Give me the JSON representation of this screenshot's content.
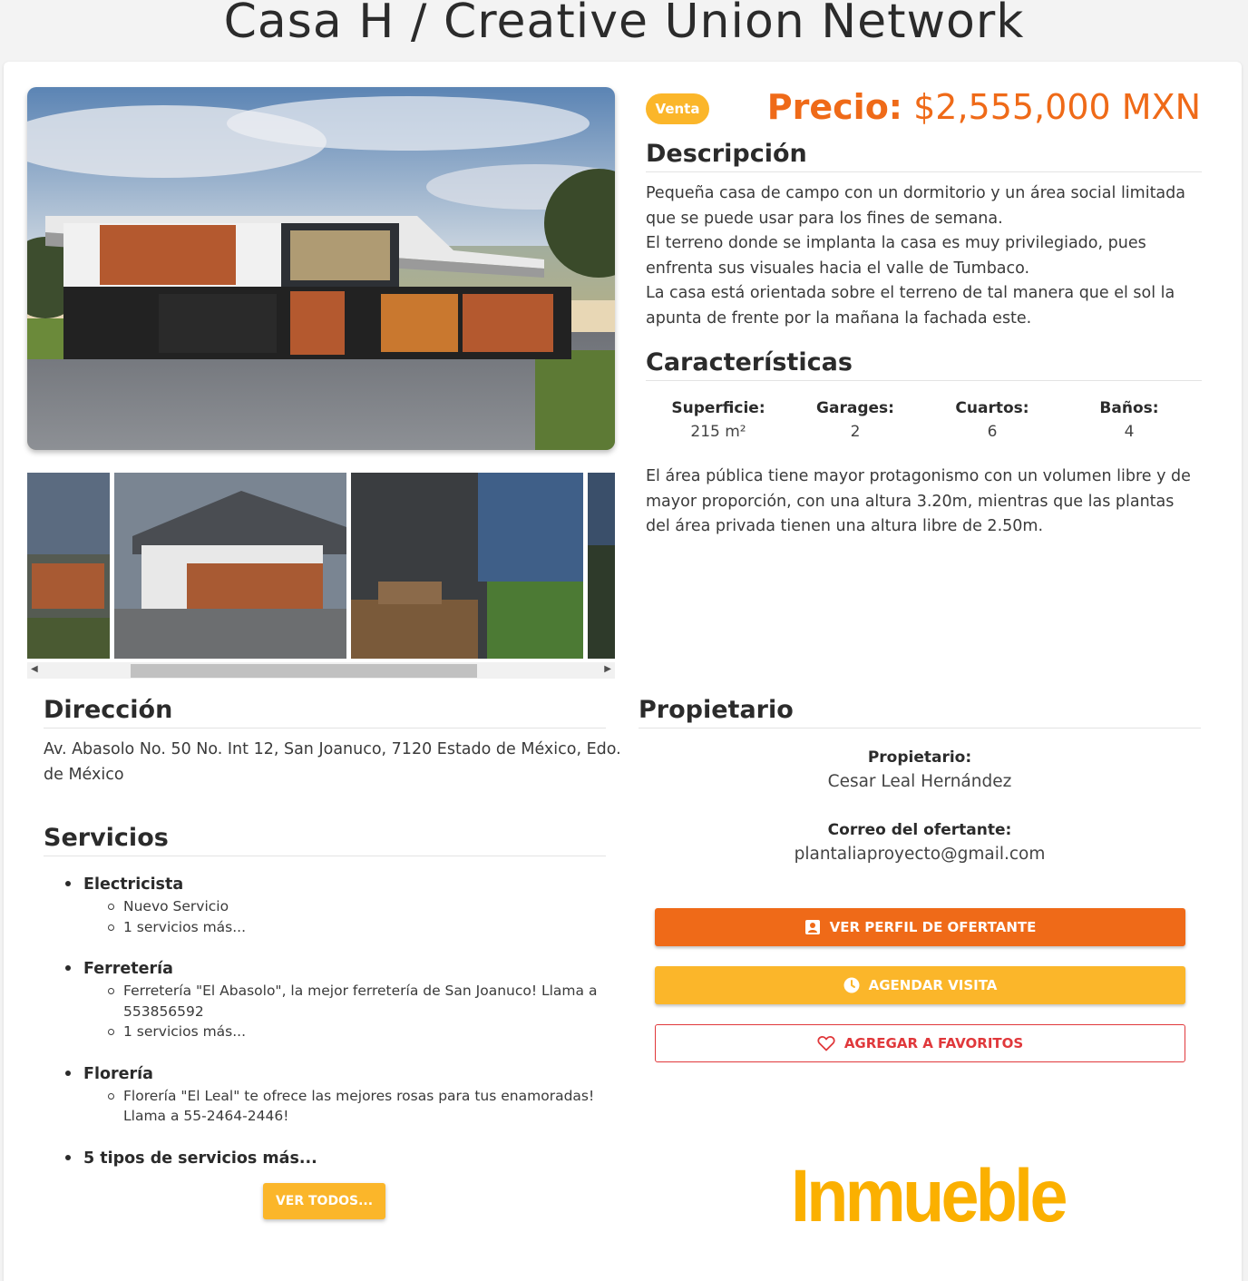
{
  "page": {
    "title": "Casa H / Creative Union Network"
  },
  "listing": {
    "badge": "Venta",
    "price_label": "Precio:",
    "price_value": "$2,555,000 MXN"
  },
  "description": {
    "heading": "Descripción",
    "lines": [
      "Pequeña casa de campo con un dormitorio y un área social limitada",
      "que se puede usar para los fines de semana.",
      "El terreno donde se implanta la casa es muy privilegiado, pues",
      "enfrenta sus visuales hacia el valle de Tumbaco.",
      "La casa está orientada sobre el terreno de tal manera que el sol la",
      "apunta de frente por la mañana la fachada este."
    ]
  },
  "features": {
    "heading": "Características",
    "items": [
      {
        "label": "Superficie:",
        "value": "215 m²"
      },
      {
        "label": "Garages:",
        "value": "2"
      },
      {
        "label": "Cuartos:",
        "value": "6"
      },
      {
        "label": "Baños:",
        "value": "4"
      }
    ],
    "note_lines": [
      "El área pública tiene mayor protagonismo con un volumen libre y de",
      "mayor proporción, con una altura 3.20m, mientras que las plantas",
      "del área privada tienen una altura libre de 2.50m."
    ]
  },
  "address": {
    "heading": "Dirección",
    "lines": [
      "Av. Abasolo No. 50 No. Int 12, San Joanuco, 7120 Estado de México, Edo.",
      "de México"
    ]
  },
  "services": {
    "heading": "Servicios",
    "categories": [
      {
        "name": "Electricista",
        "items": [
          "Nuevo Servicio",
          "1 servicios más..."
        ]
      },
      {
        "name": "Ferretería",
        "items": [
          "Ferretería \"El Abasolo\", la mejor ferretería de San Joanuco! Llama a 553856592",
          "1 servicios más..."
        ]
      },
      {
        "name": "Florería",
        "items": [
          "Florería \"El Leal\" te ofrece las mejores rosas para tus enamoradas! Llama a 55-2464-2446!"
        ]
      },
      {
        "name": "5 tipos de servicios más...",
        "items": []
      }
    ],
    "view_all_label": "VER TODOS..."
  },
  "owner": {
    "heading": "Propietario",
    "owner_label": "Propietario:",
    "owner_name": "Cesar Leal Hernández",
    "email_label": "Correo del ofertante:",
    "email": "plantaliaproyecto@gmail.com",
    "btn_profile": "VER PERFIL DE OFERTANTE",
    "btn_visit": "AGENDAR VISITA",
    "btn_favorite": "AGREGAR A FAVORITOS"
  },
  "brand": {
    "logo_text": "Inmueble"
  },
  "icons": {
    "profile": "account-box-icon",
    "visit": "clock-icon",
    "favorite": "heart-outline-icon"
  },
  "colors": {
    "primary": "#ef6a18",
    "accent": "#fbb62a",
    "favorite": "#e0383b",
    "logo": "#fbb000"
  }
}
